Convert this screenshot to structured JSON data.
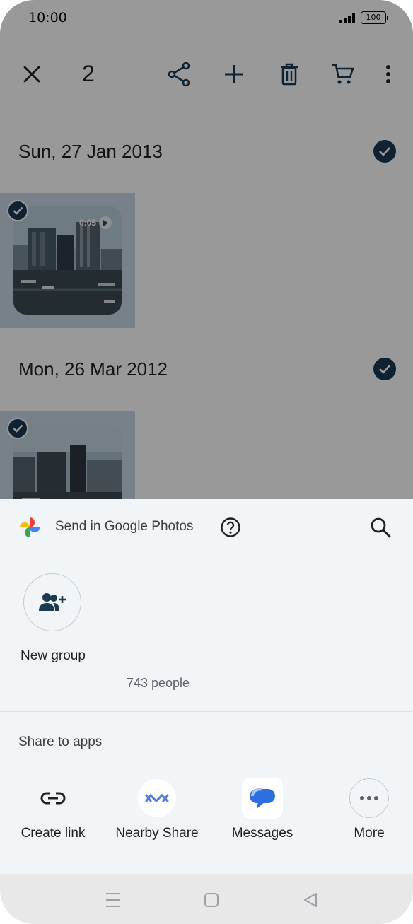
{
  "status_bar": {
    "time": "10:00",
    "battery": "100"
  },
  "toolbar": {
    "selected_count": "2"
  },
  "groups": [
    {
      "date": "Sun, 27 Jan 2013",
      "duration": "0:05"
    },
    {
      "date": "Mon, 26 Mar 2012"
    }
  ],
  "sheet": {
    "title": "Send in Google Photos",
    "new_group_label": "New group",
    "people_count": "743 people",
    "share_to_apps_title": "Share to apps",
    "apps": [
      {
        "label": "Create link",
        "icon": "link-icon"
      },
      {
        "label": "Nearby Share",
        "icon": "nearby-share-icon"
      },
      {
        "label": "Messages",
        "icon": "messages-icon"
      },
      {
        "label": "More",
        "icon": "more-horiz-icon"
      }
    ]
  },
  "colors": {
    "accent": "#1a73e8",
    "check_bg": "#1a3a52",
    "sheet_bg": "#f1f5f7",
    "scrim": "rgba(0,0,0,0.40)"
  }
}
